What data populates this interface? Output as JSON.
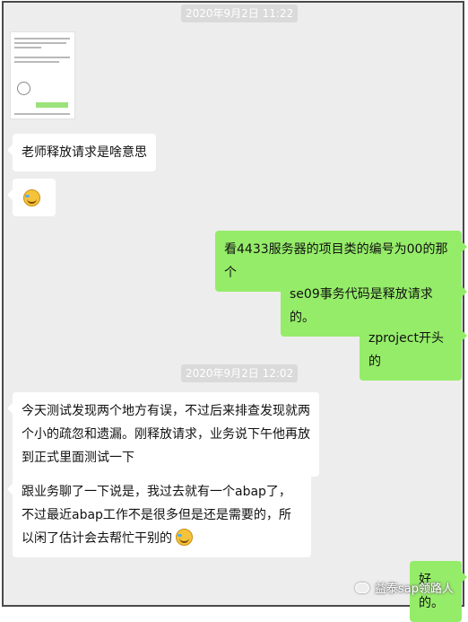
{
  "timestamps": [
    "2020年9月2日 11:22",
    "2020年9月2日 12:02"
  ],
  "messages": {
    "m1": "老师释放请求是啥意思",
    "m2": "看4433服务器的项目类的编号为00的那个",
    "m3": "se09事务代码是释放请求的。",
    "m4": "zproject开头的",
    "m5": "今天测试发现两个地方有误，不过后来排查发现就两个小的疏忽和遗漏。刚释放请求，业务说下午他再放到正式里面测试一下",
    "m6": "跟业务聊了一下说是，我过去就有一个abap了，不过最近abap工作不是很多但是还是需要的，所以闲了估计会去帮忙干别的",
    "m7": "好的。"
  },
  "watermark": "益泰sap领路人",
  "colors": {
    "chat_bg": "#ededed",
    "outgoing": "#95ec69",
    "incoming": "#ffffff"
  }
}
